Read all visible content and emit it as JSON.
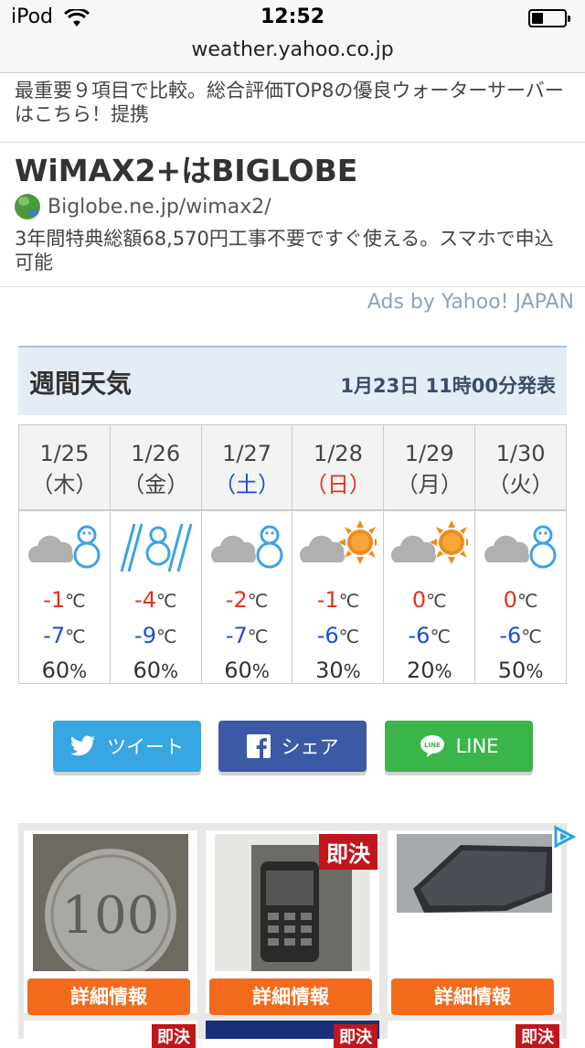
{
  "status_bar": {
    "carrier": "iPod",
    "time": "12:52",
    "battery_level": 0.35
  },
  "browser": {
    "url": "weather.yahoo.co.jp"
  },
  "ads": [
    {
      "description": "最重要９項目で比較。総合評価TOP8の優良ウォーターサーバーはこちら！提携"
    },
    {
      "title": "WiMAX2+はBIGLOBE",
      "url": "Biglobe.ne.jp/wimax2/",
      "description": "3年間特典総額68,570円工事不要ですぐ使える。スマホで申込可能"
    }
  ],
  "ads_by": "Ads by Yahoo! JAPAN",
  "weekly": {
    "title": "週間天気",
    "issued": "1月23日 11時00分発表",
    "unit": "℃",
    "percent": "%",
    "days": [
      {
        "date": "1/25",
        "weekday": "（木）",
        "icon": "cloud-snow-icon",
        "high": "-1",
        "low": "-7",
        "pop": "60"
      },
      {
        "date": "1/26",
        "weekday": "（金）",
        "icon": "snow-icon",
        "high": "-4",
        "low": "-9",
        "pop": "60"
      },
      {
        "date": "1/27",
        "weekday": "（土）",
        "icon": "cloud-snow-icon",
        "high": "-2",
        "low": "-7",
        "pop": "60"
      },
      {
        "date": "1/28",
        "weekday": "（日）",
        "icon": "cloud-sun-icon",
        "high": "-1",
        "low": "-6",
        "pop": "30"
      },
      {
        "date": "1/29",
        "weekday": "（月）",
        "icon": "cloud-sun-icon",
        "high": "0",
        "low": "-6",
        "pop": "20"
      },
      {
        "date": "1/30",
        "weekday": "（火）",
        "icon": "cloud-snow-icon",
        "high": "0",
        "low": "-6",
        "pop": "50"
      }
    ]
  },
  "share": {
    "twitter": "ツイート",
    "facebook": "シェア",
    "line": "LINE"
  },
  "products": {
    "badge": "即決",
    "detail_button": "詳細情報"
  },
  "colors": {
    "accent_blue": "#1f4fd0",
    "accent_red": "#e0341c",
    "twitter": "#37a6e2",
    "facebook": "#3b5aa6",
    "line": "#3ab54a",
    "product_button": "#f26b1d"
  }
}
